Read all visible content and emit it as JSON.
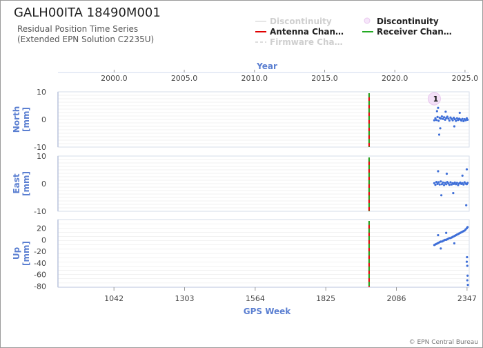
{
  "title": "GALH00ITA 18490M001",
  "subtitle_lines": [
    "Residual Position Time Series",
    "(Extended EPN Solution C2235U)"
  ],
  "legend": [
    {
      "label": "Discontinuity",
      "style": "line-faded",
      "color": "#e6e6e6"
    },
    {
      "label": "Discontinuity",
      "style": "circle",
      "color": "#e8c8ee"
    },
    {
      "label": "Antenna Chan…",
      "style": "line",
      "color": "#e00000"
    },
    {
      "label": "Receiver Chan…",
      "style": "line",
      "color": "#22aa22"
    },
    {
      "label": "Firmware Cha…",
      "style": "dashed-faded",
      "color": "#dddddd"
    }
  ],
  "credit": "© EPN Central Bureau",
  "colors": {
    "data": "#3f6fd8",
    "axis_title": "#5b7fd1",
    "grid": "#e6e6e6",
    "antenna": "#e00000",
    "receiver": "#22aa22"
  },
  "chart_data": {
    "type": "scatter",
    "top_axis": {
      "title": "Year",
      "ticks": [
        "2000.0",
        "2005.0",
        "2010.0",
        "2015.0",
        "2020.0",
        "2025.0"
      ],
      "tick_values": [
        2000.0,
        2005.0,
        2010.0,
        2015.0,
        2020.0,
        2025.0
      ],
      "range": [
        1996.0,
        2025.3
      ]
    },
    "bottom_axis": {
      "title": "GPS Week",
      "ticks": [
        "1042",
        "1303",
        "1564",
        "1825",
        "2086",
        "2347"
      ],
      "tick_values": [
        1042,
        1303,
        1564,
        1825,
        2086,
        2347
      ],
      "range": [
        835,
        2355
      ]
    },
    "antenna_change_week": 1985,
    "receiver_change_week": 1985,
    "discontinuity_marker": {
      "label": "1",
      "week": 2226
    },
    "data_span_weeks": [
      2224,
      2350
    ],
    "panels": [
      {
        "name": "North",
        "ylabel_lines": [
          "North",
          "[mm]"
        ],
        "ylim": [
          -10,
          10
        ],
        "yticks": [
          10,
          0,
          -10
        ],
        "points": [
          [
            2226,
            -0.3
          ],
          [
            2230,
            0.4
          ],
          [
            2234,
            -0.2
          ],
          [
            2238,
            0.9
          ],
          [
            2242,
            -0.5
          ],
          [
            2246,
            0.6
          ],
          [
            2250,
            0.3
          ],
          [
            2254,
            1.1
          ],
          [
            2258,
            0.2
          ],
          [
            2262,
            0.8
          ],
          [
            2266,
            -0.1
          ],
          [
            2270,
            0.5
          ],
          [
            2274,
            1.0
          ],
          [
            2278,
            0.3
          ],
          [
            2282,
            -0.4
          ],
          [
            2286,
            0.7
          ],
          [
            2290,
            0.2
          ],
          [
            2294,
            -0.3
          ],
          [
            2298,
            0.6
          ],
          [
            2302,
            0.1
          ],
          [
            2306,
            -0.5
          ],
          [
            2310,
            0.4
          ],
          [
            2314,
            -0.2
          ],
          [
            2318,
            0.3
          ],
          [
            2322,
            0.0
          ],
          [
            2326,
            -0.4
          ],
          [
            2330,
            0.2
          ],
          [
            2334,
            -0.6
          ],
          [
            2338,
            0.1
          ],
          [
            2342,
            -0.3
          ],
          [
            2346,
            0.4
          ],
          [
            2349,
            -0.1
          ],
          [
            2236,
            3.0
          ],
          [
            2248,
            -3.2
          ],
          [
            2268,
            2.8
          ],
          [
            2300,
            -2.5
          ],
          [
            2320,
            2.4
          ],
          [
            2244,
            -5.5
          ],
          [
            2240,
            4.2
          ]
        ]
      },
      {
        "name": "East",
        "ylabel_lines": [
          "East",
          "[mm]"
        ],
        "ylim": [
          -10,
          10
        ],
        "yticks": [
          10,
          0,
          -10
        ],
        "points": [
          [
            2226,
            0.2
          ],
          [
            2230,
            -0.4
          ],
          [
            2234,
            0.6
          ],
          [
            2238,
            -0.1
          ],
          [
            2242,
            0.5
          ],
          [
            2246,
            -0.3
          ],
          [
            2250,
            0.8
          ],
          [
            2254,
            -0.2
          ],
          [
            2258,
            0.4
          ],
          [
            2262,
            -0.5
          ],
          [
            2266,
            0.3
          ],
          [
            2270,
            -0.2
          ],
          [
            2274,
            0.6
          ],
          [
            2278,
            0.1
          ],
          [
            2282,
            -0.4
          ],
          [
            2286,
            0.5
          ],
          [
            2290,
            -0.3
          ],
          [
            2294,
            0.2
          ],
          [
            2298,
            -0.1
          ],
          [
            2302,
            0.4
          ],
          [
            2306,
            -0.2
          ],
          [
            2310,
            0.3
          ],
          [
            2314,
            -0.5
          ],
          [
            2318,
            0.1
          ],
          [
            2322,
            0.4
          ],
          [
            2326,
            -0.1
          ],
          [
            2330,
            0.2
          ],
          [
            2334,
            -0.3
          ],
          [
            2338,
            0.5
          ],
          [
            2342,
            0.0
          ],
          [
            2346,
            -0.2
          ],
          [
            2349,
            0.3
          ],
          [
            2240,
            4.5
          ],
          [
            2252,
            -4.2
          ],
          [
            2272,
            3.6
          ],
          [
            2296,
            -3.4
          ],
          [
            2330,
            2.9
          ],
          [
            2346,
            5.2
          ],
          [
            2344,
            -7.8
          ]
        ]
      },
      {
        "name": "Up",
        "ylabel_lines": [
          "Up",
          "[mm]"
        ],
        "ylim": [
          -82,
          35
        ],
        "yticks": [
          20,
          0,
          -20,
          -40,
          -60,
          -80
        ],
        "points": [
          [
            2226,
            -9
          ],
          [
            2230,
            -8
          ],
          [
            2234,
            -7
          ],
          [
            2238,
            -6
          ],
          [
            2242,
            -5
          ],
          [
            2246,
            -4
          ],
          [
            2250,
            -3
          ],
          [
            2254,
            -3
          ],
          [
            2258,
            -2
          ],
          [
            2262,
            -1
          ],
          [
            2266,
            0
          ],
          [
            2270,
            0
          ],
          [
            2274,
            1
          ],
          [
            2278,
            2
          ],
          [
            2282,
            3
          ],
          [
            2286,
            3
          ],
          [
            2290,
            4
          ],
          [
            2294,
            5
          ],
          [
            2298,
            6
          ],
          [
            2302,
            7
          ],
          [
            2306,
            8
          ],
          [
            2310,
            9
          ],
          [
            2314,
            10
          ],
          [
            2318,
            11
          ],
          [
            2322,
            12
          ],
          [
            2326,
            13
          ],
          [
            2330,
            14
          ],
          [
            2334,
            15
          ],
          [
            2338,
            16
          ],
          [
            2342,
            18
          ],
          [
            2346,
            20
          ],
          [
            2349,
            22
          ],
          [
            2240,
            8
          ],
          [
            2250,
            -15
          ],
          [
            2270,
            12
          ],
          [
            2300,
            -6
          ],
          [
            2347,
            -30
          ],
          [
            2348,
            -45
          ],
          [
            2349,
            -62
          ],
          [
            2350,
            -78
          ],
          [
            2346,
            -38
          ],
          [
            2348,
            -70
          ]
        ]
      }
    ]
  }
}
